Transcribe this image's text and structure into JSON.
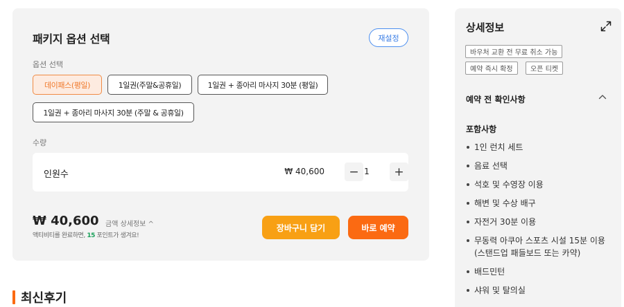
{
  "options": {
    "title": "패키지 옵션 선택",
    "reset_label": "재설정",
    "section_label": "옵션 선택",
    "items": [
      {
        "label": "데이패스(평일)",
        "selected": true
      },
      {
        "label": "1일권(주말&공휴일)",
        "selected": false
      },
      {
        "label": "1일권 + 종아리 마사지 30분 (평일)",
        "selected": false
      },
      {
        "label": "1일권 + 종아리 마사지 30분 (주말 & 공휴일)",
        "selected": false
      }
    ]
  },
  "quantity": {
    "section_label": "수량",
    "row_label": "인원수",
    "unit_price": "₩ 40,600",
    "minus": "−",
    "value": "1",
    "plus": "+"
  },
  "summary": {
    "total": "₩ 40,600",
    "detail_link": "금액 상세정보 ^",
    "note_prefix": "액티비티를 완료하면, ",
    "note_points": "15",
    "note_suffix": " 포인트가 생겨요!",
    "cart_label": "장바구니 담기",
    "book_label": "바로 예약"
  },
  "reviews": {
    "title": "최신후기"
  },
  "details": {
    "title": "상세정보",
    "tags": [
      "바우처 교환 전 무료 취소 가능",
      "예약 즉시 확정",
      "오픈 티켓"
    ],
    "pre_booking_heading": "예약 전 확인사항",
    "included_heading": "포함사항",
    "included": [
      "1인 런치 세트",
      "음료 선택",
      "석호 및 수영장 이용",
      "해변 및 수상 배구",
      "자전거 30분 이용",
      "무동력 아쿠아 스포츠 시설 15분 이용 (스탠드업 패들보드 또는 카약)",
      "배드민턴",
      "샤워 및 탈의실"
    ]
  },
  "colors": {
    "accent": "#fb6a12",
    "cart": "#f8a014",
    "link_blue": "#3a7ee6",
    "points_green": "#1aa05a"
  },
  "icons": {
    "expand": "expand-arrows-icon",
    "collapse": "chevron-up-icon"
  }
}
